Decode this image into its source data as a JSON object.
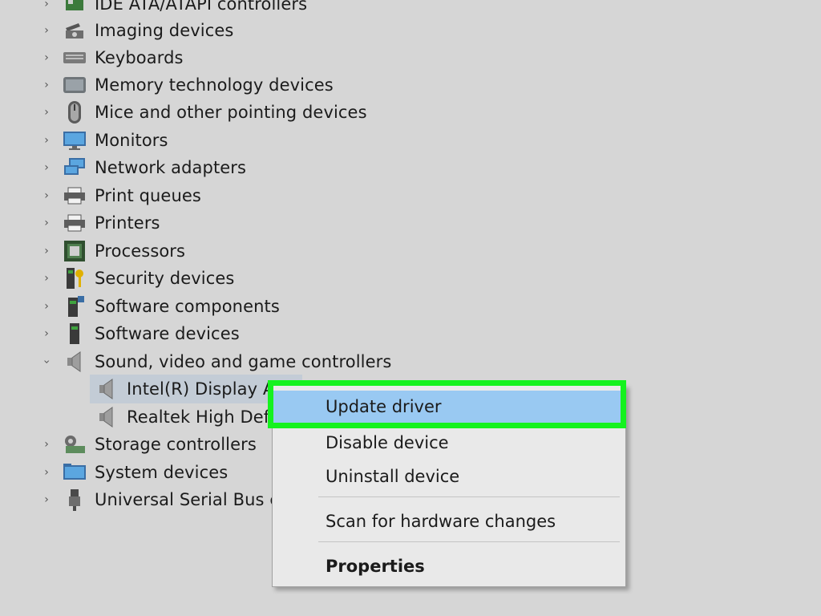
{
  "tree": {
    "categories": [
      {
        "label": "IDE ATA/ATAPI controllers",
        "icon": "ide-controller-icon",
        "expanded": false
      },
      {
        "label": "Imaging devices",
        "icon": "camera-icon",
        "expanded": false
      },
      {
        "label": "Keyboards",
        "icon": "keyboard-icon",
        "expanded": false
      },
      {
        "label": "Memory technology devices",
        "icon": "memory-icon",
        "expanded": false
      },
      {
        "label": "Mice and other pointing devices",
        "icon": "mouse-icon",
        "expanded": false
      },
      {
        "label": "Monitors",
        "icon": "monitor-icon",
        "expanded": false
      },
      {
        "label": "Network adapters",
        "icon": "network-icon",
        "expanded": false
      },
      {
        "label": "Print queues",
        "icon": "printer-icon",
        "expanded": false
      },
      {
        "label": "Printers",
        "icon": "printer-icon",
        "expanded": false
      },
      {
        "label": "Processors",
        "icon": "processor-icon",
        "expanded": false
      },
      {
        "label": "Security devices",
        "icon": "security-key-icon",
        "expanded": false
      },
      {
        "label": "Software components",
        "icon": "software-component-icon",
        "expanded": false
      },
      {
        "label": "Software devices",
        "icon": "software-device-icon",
        "expanded": false
      },
      {
        "label": "Sound, video and game controllers",
        "icon": "speaker-icon",
        "expanded": true
      },
      {
        "label": "Storage controllers",
        "icon": "storage-icon",
        "expanded": false
      },
      {
        "label": "System devices",
        "icon": "system-folder-icon",
        "expanded": false
      },
      {
        "label": "Universal Serial Bus co",
        "icon": "usb-icon",
        "expanded": false
      }
    ],
    "sound_children": [
      {
        "label": "Intel(R) Display Au",
        "icon": "speaker-icon",
        "selected": true
      },
      {
        "label": "Realtek High Defir",
        "icon": "speaker-icon",
        "selected": false
      }
    ]
  },
  "context_menu": {
    "items": [
      {
        "label": "Update driver",
        "highlighted": true
      },
      {
        "label": "Disable device"
      },
      {
        "label": "Uninstall device"
      },
      {
        "label": "Scan for hardware changes"
      },
      {
        "label": "Properties",
        "bold": true
      }
    ],
    "highlight_color": "#15f21f",
    "hover_color": "#99c9f2"
  }
}
